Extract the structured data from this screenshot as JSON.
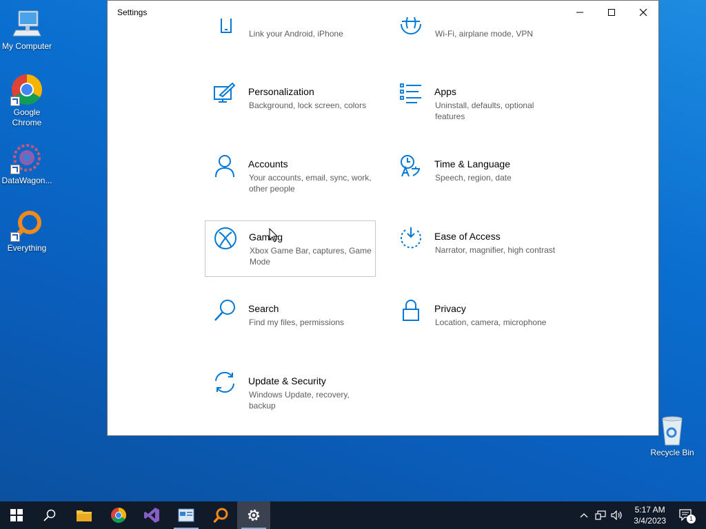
{
  "desktop": {
    "icons": [
      {
        "label": "My Computer"
      },
      {
        "label": "Google Chrome"
      },
      {
        "label": "DataWagon..."
      },
      {
        "label": "Everything"
      },
      {
        "label": "Recycle Bin"
      }
    ]
  },
  "window": {
    "title": "Settings",
    "controls": {
      "minimize": "—",
      "maximize": "☐",
      "close": "✕"
    }
  },
  "settings": {
    "categories": [
      {
        "name": "",
        "desc": "Link your Android, iPhone",
        "icon": "phone-icon"
      },
      {
        "name": "",
        "desc": "Wi-Fi, airplane mode, VPN",
        "icon": "globe-icon"
      },
      {
        "name": "Personalization",
        "desc": "Background, lock screen, colors",
        "icon": "paint-brush-icon"
      },
      {
        "name": "Apps",
        "desc": "Uninstall, defaults, optional features",
        "icon": "apps-list-icon"
      },
      {
        "name": "Accounts",
        "desc": "Your accounts, email, sync, work, other people",
        "icon": "person-icon"
      },
      {
        "name": "Time & Language",
        "desc": "Speech, region, date",
        "icon": "time-language-icon"
      },
      {
        "name": "Gaming",
        "desc": "Xbox Game Bar, captures, Game Mode",
        "icon": "xbox-icon"
      },
      {
        "name": "Ease of Access",
        "desc": "Narrator, magnifier, high contrast",
        "icon": "ease-of-access-icon"
      },
      {
        "name": "Search",
        "desc": "Find my files, permissions",
        "icon": "search-icon"
      },
      {
        "name": "Privacy",
        "desc": "Location, camera, microphone",
        "icon": "lock-icon"
      },
      {
        "name": "Update & Security",
        "desc": "Windows Update, recovery, backup",
        "icon": "sync-icon"
      }
    ]
  },
  "taskbar": {
    "clock_time": "5:17 AM",
    "clock_date": "3/4/2023",
    "notification_count": "1",
    "accent": "#0078d7"
  }
}
